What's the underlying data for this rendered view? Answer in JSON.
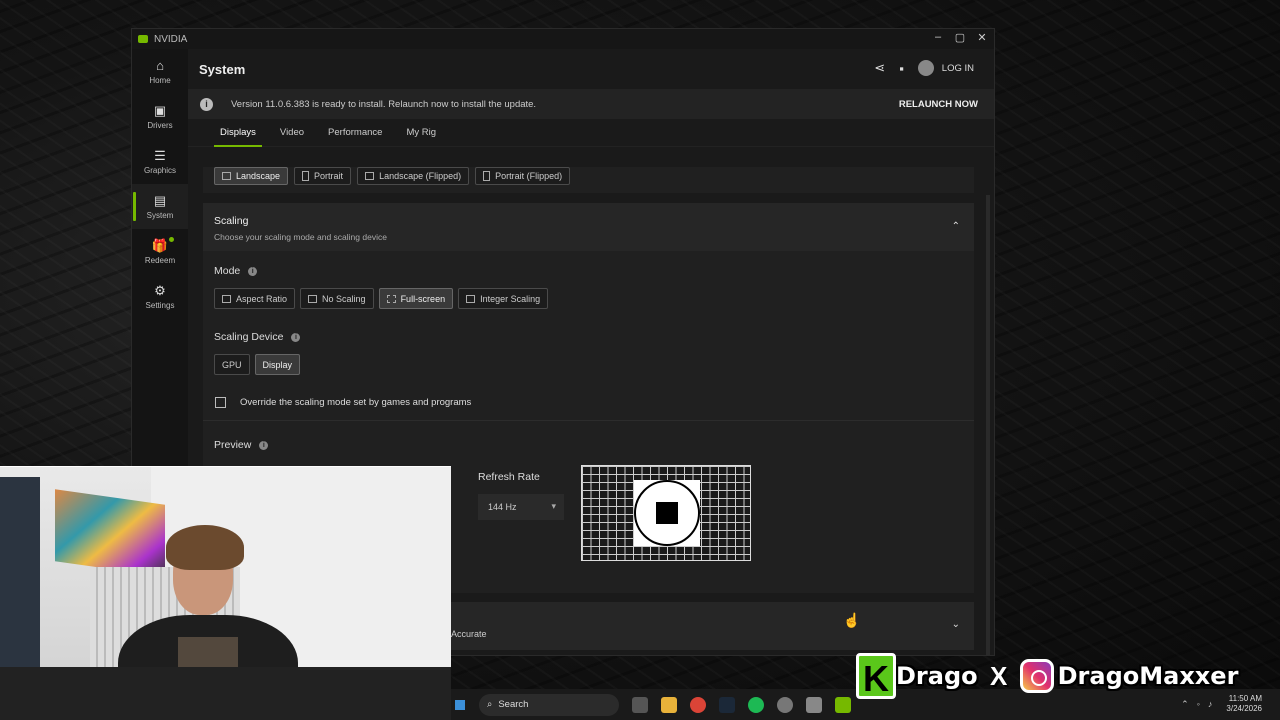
{
  "window": {
    "app_title": "NVIDIA",
    "controls": [
      "–",
      "▢",
      "✕"
    ]
  },
  "sidebar": {
    "items": [
      {
        "label": "Home",
        "icon": "⌂"
      },
      {
        "label": "Drivers",
        "icon": "▣"
      },
      {
        "label": "Graphics",
        "icon": "☰"
      },
      {
        "label": "System",
        "icon": "▤"
      },
      {
        "label": "Redeem",
        "icon": "🎁"
      },
      {
        "label": "Settings",
        "icon": "⚙"
      }
    ],
    "accent_color": "#76b900"
  },
  "header": {
    "title": "System",
    "login_label": "LOG IN"
  },
  "banner": {
    "message": "Version 11.0.6.383 is ready to install. Relaunch now to install the update.",
    "action": "RELAUNCH NOW"
  },
  "tabs": [
    "Displays",
    "Video",
    "Performance",
    "My Rig"
  ],
  "orientation": {
    "options": [
      "Landscape",
      "Portrait",
      "Landscape (Flipped)",
      "Portrait (Flipped)"
    ],
    "selected": "Landscape"
  },
  "scaling": {
    "title": "Scaling",
    "subtitle": "Choose your scaling mode and scaling device",
    "mode_label": "Mode",
    "modes": [
      "Aspect Ratio",
      "No Scaling",
      "Full-screen",
      "Integer Scaling"
    ],
    "selected_mode": "Full-screen",
    "device_label": "Scaling Device",
    "devices": [
      "GPU",
      "Display"
    ],
    "selected_device": "Display",
    "override_label": "Override the scaling mode set by games and programs",
    "preview_label": "Preview",
    "refresh_label": "Refresh Rate",
    "refresh_value": "144 Hz"
  },
  "collapsed_section": {
    "visible_text": "Accurate"
  },
  "taskbar": {
    "search_placeholder": "Search",
    "time": "11:50 AM",
    "date": "3/24/2026"
  },
  "social": {
    "k_letter": "K",
    "handle_1": "Drago",
    "x_letter": "X",
    "handle_2": "DragoMaxxer"
  }
}
